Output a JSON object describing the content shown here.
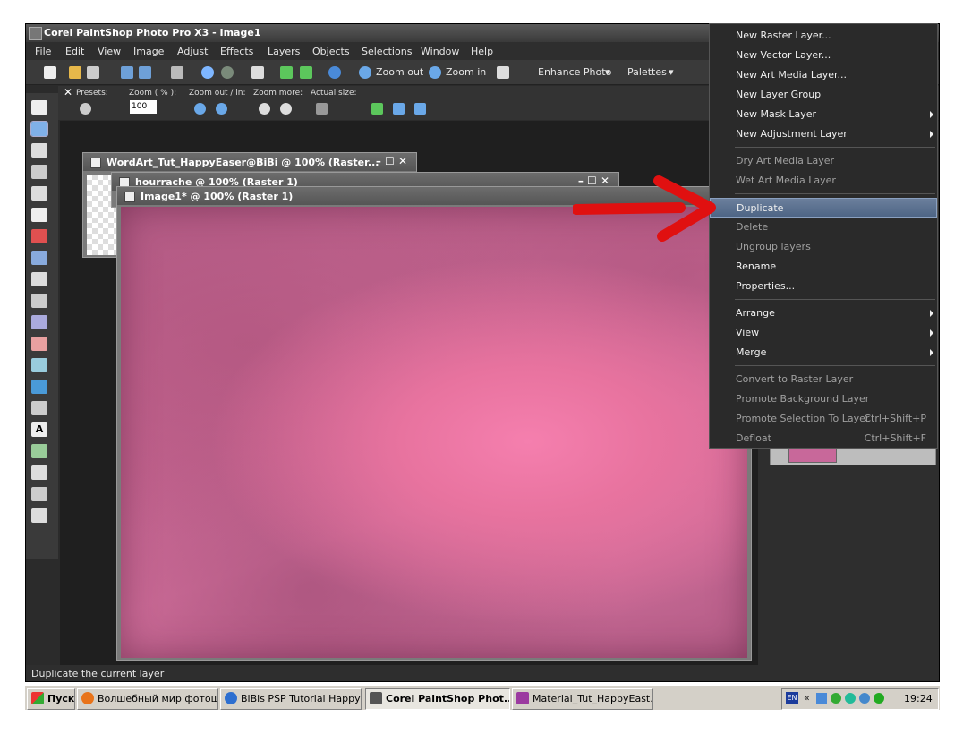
{
  "window": {
    "title": "Corel PaintShop Photo Pro X3 - Image1"
  },
  "menubar": [
    "File",
    "Edit",
    "View",
    "Image",
    "Adjust",
    "Effects",
    "Layers",
    "Objects",
    "Selections",
    "Window",
    "Help"
  ],
  "toolbar1": {
    "zoom_out": "Zoom out",
    "zoom_in": "Zoom in",
    "enhance": "Enhance Photo",
    "palettes": "Palettes"
  },
  "toolbar2": {
    "presets": "Presets:",
    "zoom_pct": "Zoom ( % ):",
    "zoom_value": "100",
    "zoom_out_in": "Zoom out / in:",
    "zoom_more": "Zoom more:",
    "actual_size": "Actual size:"
  },
  "docs": {
    "wordart": "WordArt_Tut_HappyEaser@BiBi @ 100% (Raster...",
    "hourrache": "hourrache @ 100% (Raster 1)",
    "image1": "Image1* @ 100% (Raster 1)"
  },
  "status": "Duplicate the current layer",
  "context_menu": [
    {
      "label": "New Raster Layer...",
      "enabled": true
    },
    {
      "label": "New Vector Layer...",
      "enabled": true
    },
    {
      "label": "New Art Media Layer...",
      "enabled": true
    },
    {
      "label": "New Layer Group",
      "enabled": true
    },
    {
      "label": "New Mask Layer",
      "enabled": true,
      "submenu": true
    },
    {
      "label": "New Adjustment Layer",
      "enabled": true,
      "submenu": true
    },
    {
      "label": "Dry Art Media Layer",
      "enabled": false
    },
    {
      "label": "Wet Art Media Layer",
      "enabled": false
    },
    {
      "label": "Duplicate",
      "enabled": true,
      "highlighted": true
    },
    {
      "label": "Delete",
      "enabled": false
    },
    {
      "label": "Ungroup layers",
      "enabled": false
    },
    {
      "label": "Rename",
      "enabled": true
    },
    {
      "label": "Properties...",
      "enabled": true
    },
    {
      "label": "Arrange",
      "enabled": true,
      "submenu": true
    },
    {
      "label": "View",
      "enabled": true,
      "submenu": true
    },
    {
      "label": "Merge",
      "enabled": true,
      "submenu": true
    },
    {
      "label": "Convert to Raster Layer",
      "enabled": false
    },
    {
      "label": "Promote Background Layer",
      "enabled": false
    },
    {
      "label": "Promote Selection To Layer",
      "enabled": false,
      "shortcut": "Ctrl+Shift+P"
    },
    {
      "label": "Defloat",
      "enabled": false,
      "shortcut": "Ctrl+Shift+F"
    }
  ],
  "taskbar": {
    "start": "Пуск",
    "items": [
      {
        "label": "Волшебный мир фотош...",
        "icon": "firefox-icon",
        "color": "#e8731a"
      },
      {
        "label": "BiBis PSP Tutorial Happy ...",
        "icon": "ie-icon",
        "color": "#2d6fd0"
      },
      {
        "label": "Corel PaintShop Phot...",
        "icon": "psp-icon",
        "color": "#555555",
        "active": true
      },
      {
        "label": "Material_Tut_HappyEast...",
        "icon": "winrar-icon",
        "color": "#9b3aa0"
      }
    ],
    "lang": "EN",
    "clock": "19:24"
  },
  "colors": {
    "highlight": "#5a7090",
    "arrow": "#e01010",
    "canvas_pink": "#f07aa8"
  }
}
